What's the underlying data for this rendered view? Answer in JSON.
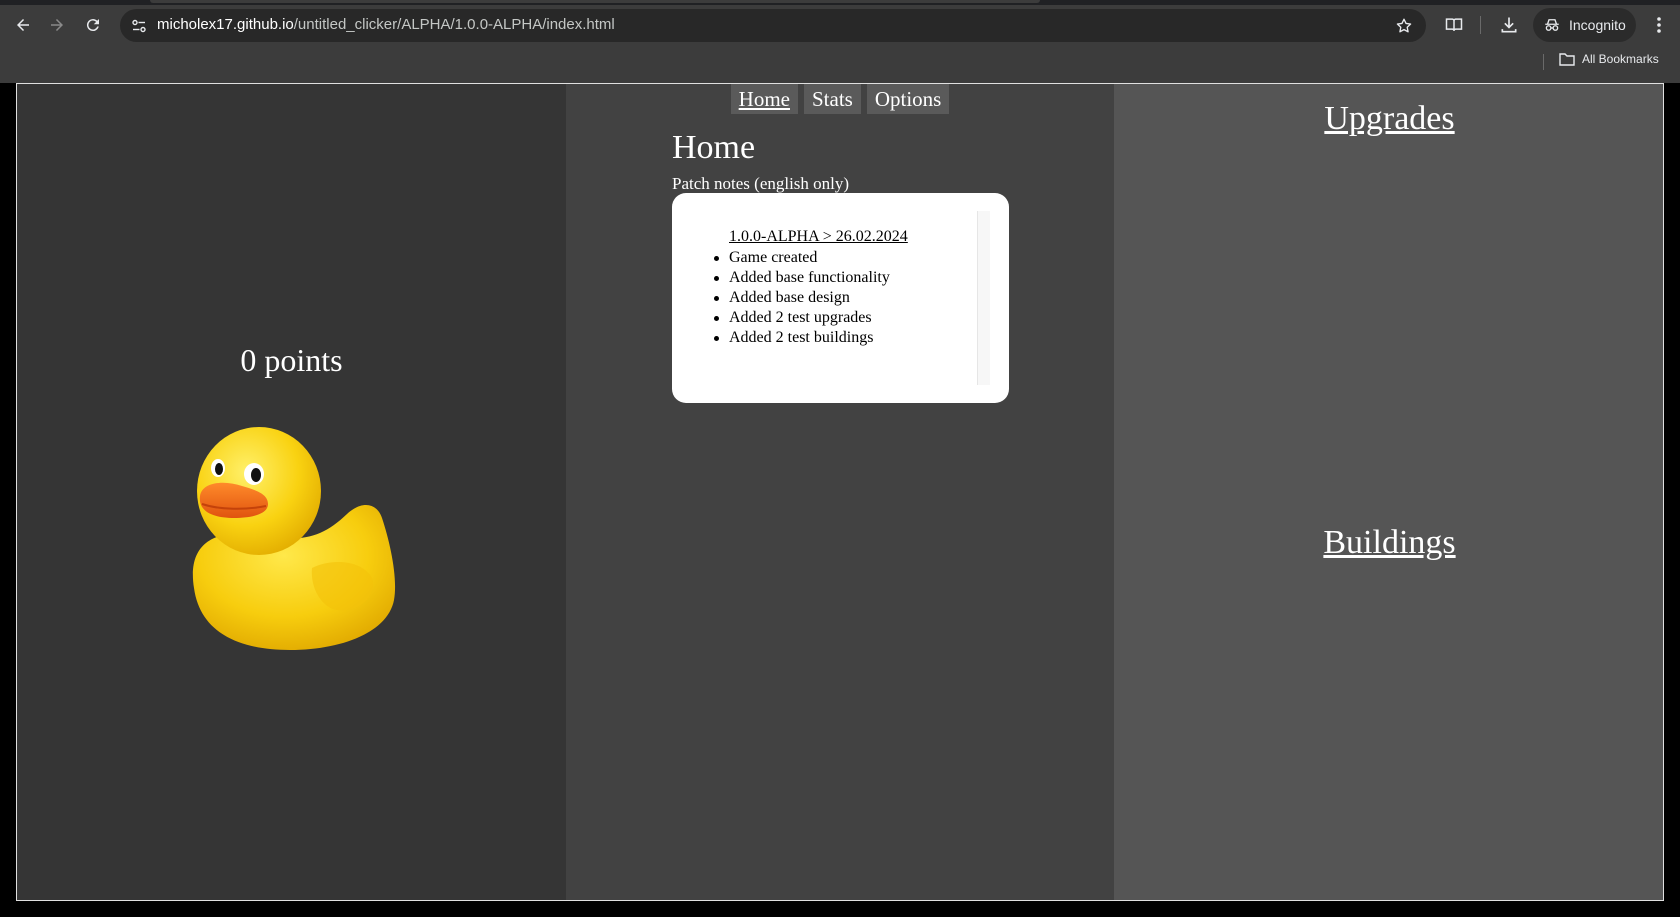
{
  "browser": {
    "url_host": "micholex17.github.io",
    "url_path": "/untitled_clicker/ALPHA/1.0.0-ALPHA/index.html",
    "incognito_label": "Incognito",
    "bookmarks_label": "All Bookmarks",
    "icons": [
      "back-icon",
      "forward-icon",
      "reload-icon",
      "site-info-icon",
      "star-icon",
      "reader-mode-icon",
      "download-icon",
      "incognito-icon",
      "menu-icon",
      "folder-icon"
    ]
  },
  "game": {
    "points_text": "0 points",
    "duck_image": "rubber-duck",
    "nav": {
      "tabs": [
        {
          "label": "Home",
          "active": true
        },
        {
          "label": "Stats",
          "active": false
        },
        {
          "label": "Options",
          "active": false
        }
      ]
    },
    "home": {
      "title": "Home",
      "patch_label": "Patch notes (english only)",
      "patch": {
        "version": "1.0.0-ALPHA > 26.02.2024",
        "items": [
          "Game created",
          "Added base functionality",
          "Added base design",
          "Added 2 test upgrades",
          "Added 2 test buildings"
        ]
      }
    },
    "upgrades_title": "Upgrades",
    "buildings_title": "Buildings"
  },
  "colors": {
    "left_panel": "#353535",
    "middle_panel": "#424242",
    "right_panel": "#555555",
    "duck_yellow": "#f7cd0e",
    "duck_beak": "#f06a1a"
  }
}
